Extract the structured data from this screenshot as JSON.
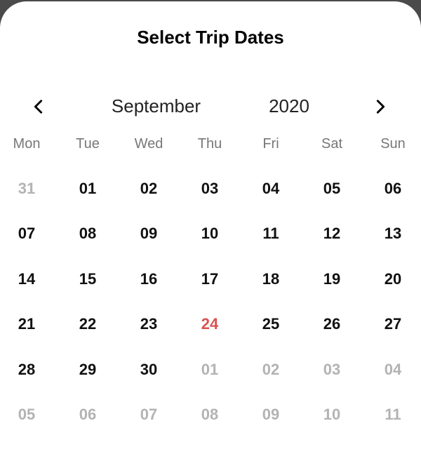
{
  "dialog": {
    "title": "Select Trip Dates"
  },
  "calendar": {
    "month": "September",
    "year": "2020",
    "weekdays": [
      "Mon",
      "Tue",
      "Wed",
      "Thu",
      "Fri",
      "Sat",
      "Sun"
    ],
    "weeks": [
      [
        {
          "label": "31",
          "state": "outside"
        },
        {
          "label": "01",
          "state": "current"
        },
        {
          "label": "02",
          "state": "current"
        },
        {
          "label": "03",
          "state": "current"
        },
        {
          "label": "04",
          "state": "current"
        },
        {
          "label": "05",
          "state": "current"
        },
        {
          "label": "06",
          "state": "current"
        }
      ],
      [
        {
          "label": "07",
          "state": "current"
        },
        {
          "label": "08",
          "state": "current"
        },
        {
          "label": "09",
          "state": "current"
        },
        {
          "label": "10",
          "state": "current"
        },
        {
          "label": "11",
          "state": "current"
        },
        {
          "label": "12",
          "state": "current"
        },
        {
          "label": "13",
          "state": "current"
        }
      ],
      [
        {
          "label": "14",
          "state": "current"
        },
        {
          "label": "15",
          "state": "current"
        },
        {
          "label": "16",
          "state": "current"
        },
        {
          "label": "17",
          "state": "current"
        },
        {
          "label": "18",
          "state": "current"
        },
        {
          "label": "19",
          "state": "current"
        },
        {
          "label": "20",
          "state": "current"
        }
      ],
      [
        {
          "label": "21",
          "state": "current"
        },
        {
          "label": "22",
          "state": "current"
        },
        {
          "label": "23",
          "state": "current"
        },
        {
          "label": "24",
          "state": "today"
        },
        {
          "label": "25",
          "state": "current"
        },
        {
          "label": "26",
          "state": "current"
        },
        {
          "label": "27",
          "state": "current"
        }
      ],
      [
        {
          "label": "28",
          "state": "current"
        },
        {
          "label": "29",
          "state": "current"
        },
        {
          "label": "30",
          "state": "current"
        },
        {
          "label": "01",
          "state": "outside"
        },
        {
          "label": "02",
          "state": "outside"
        },
        {
          "label": "03",
          "state": "outside"
        },
        {
          "label": "04",
          "state": "outside"
        }
      ],
      [
        {
          "label": "05",
          "state": "outside"
        },
        {
          "label": "06",
          "state": "outside"
        },
        {
          "label": "07",
          "state": "outside"
        },
        {
          "label": "08",
          "state": "outside"
        },
        {
          "label": "09",
          "state": "outside"
        },
        {
          "label": "10",
          "state": "outside"
        },
        {
          "label": "11",
          "state": "outside"
        }
      ]
    ]
  },
  "icons": {
    "prev": "chevron-left-icon",
    "next": "chevron-right-icon"
  },
  "colors": {
    "today": "#d9534f",
    "outside": "#b3b3b3",
    "day": "#111111",
    "weekday": "#777777"
  }
}
